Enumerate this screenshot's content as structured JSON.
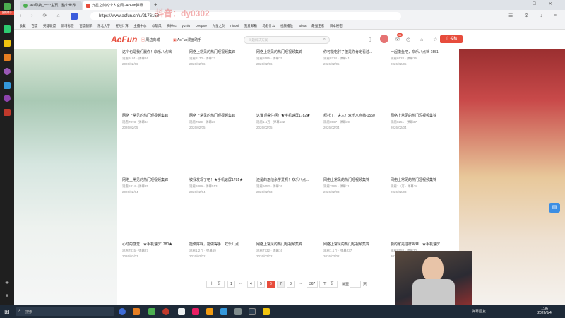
{
  "browser": {
    "sidebar_badge": "团购帮手",
    "tabs": [
      {
        "label": "360导航_一个主页，整个世界",
        "active": false
      },
      {
        "label": "九星之剑的个人空间 -AcFun弹幕...",
        "active": true
      }
    ],
    "url": "https://www.acfun.cn/u/2176158",
    "watermark": "抖音：dy0302",
    "bookmarks": [
      "收藏",
      "百度",
      "英雄联盟",
      "新增标签",
      "百度翻译",
      "东北大学",
      "在线计算",
      "主播中心",
      "@斩风",
      "梅棒cc",
      "yizhiu",
      "DeepSe",
      "九星之剑",
      "nicool",
      "我爱邮箱",
      "马老什么",
      "视频播放",
      "lolMa",
      "最强王者",
      "日本秘密"
    ]
  },
  "site": {
    "logo": "AcFun",
    "nav": [
      "周边商城",
      "AcFun漫画助手"
    ],
    "search_placeholder": "问题解决方案",
    "notif_count": "34",
    "upload_label": "投稿"
  },
  "videos": [
    {
      "title": "这个也是我们戳你！欢乐八点档",
      "views": "观看9101",
      "danmaku": "弹幕16",
      "date": "2026/02/06"
    },
    {
      "title": "网络上常见的热门短视频集锦",
      "views": "观看8170",
      "danmaku": "弹幕22",
      "date": "2026/02/06"
    },
    {
      "title": "网络上常见的热门短视频集锦",
      "views": "观看5585",
      "danmaku": "弹幕25",
      "date": "2026/02/06"
    },
    {
      "title": "你可能吃肘子但是你肯定看过...",
      "views": "观看8214",
      "danmaku": "弹幕41",
      "date": "2026/02/05"
    },
    {
      "title": "一起摸鱼吧，欢乐八点档-1551",
      "views": "观看6528",
      "danmaku": "弹幕26",
      "date": "2026/02/05"
    },
    {
      "title": "网络上常见的热门短视频集锦",
      "views": "观看7873",
      "danmaku": "弹幕34",
      "date": "2026/02/05"
    },
    {
      "title": "网络上常见的热门短视频集锦",
      "views": "观看7829",
      "danmaku": "弹幕28",
      "date": "2026/02/05"
    },
    {
      "title": "这谁顶得住啊！★手机速屏1782★",
      "views": "观看1.6万",
      "danmaku": "弹幕532",
      "date": "2026/02/05"
    },
    {
      "title": "拜托了，夫人！欢乐八点档-1550",
      "views": "观看8567",
      "danmaku": "弹幕39",
      "date": "2026/02/04"
    },
    {
      "title": "网络上常见的热门短视频集锦",
      "views": "观看8251",
      "danmaku": "弹幕37",
      "date": "2026/02/04"
    },
    {
      "title": "网络上常见的热门短视频集锦",
      "views": "观看6314",
      "danmaku": "弹幕25",
      "date": "2026/02/04"
    },
    {
      "title": "被我发现了吧！★手机速屏1781★",
      "views": "观看9389",
      "danmaku": "弹幕513",
      "date": "2026/02/04"
    },
    {
      "title": "还是的急他余学爱啊！欢乐八点...",
      "views": "观看6652",
      "danmaku": "弹幕26",
      "date": "2026/02/03"
    },
    {
      "title": "网络上常见的热门短视频集锦",
      "views": "观看7586",
      "danmaku": "弹幕11",
      "date": "2026/02/03"
    },
    {
      "title": "网络上常见的热门短视频集锦",
      "views": "观看1.1万",
      "danmaku": "弹幕38",
      "date": "2026/02/03"
    },
    {
      "title": "心动的感觉！★手机速屏1780★",
      "views": "观看7815",
      "danmaku": "弹幕27",
      "date": "2026/02/03"
    },
    {
      "title": "能做好啊，能做得手！欢乐八点...",
      "views": "观看1.2万",
      "danmaku": "弹幕69",
      "date": "2026/02/02"
    },
    {
      "title": "网络上常见的热门短视频集锦",
      "views": "观看7732",
      "danmaku": "弹幕16",
      "date": "2026/02/02"
    },
    {
      "title": "网络上常见的热门短视频集锦",
      "views": "观看1.1万",
      "danmaku": "弹幕237",
      "date": "2026/02/02"
    },
    {
      "title": "要的家是这样喝难！★手机速屏...",
      "views": "观看8558",
      "danmaku": "弹幕30",
      "date": "2026/02/02"
    }
  ],
  "pagination": {
    "prev": "上一页",
    "pages": [
      "1",
      "...",
      "4",
      "5",
      "6",
      "7",
      "8",
      "...",
      "367"
    ],
    "current": "6",
    "next": "下一页",
    "goto_label": "跳至",
    "page_unit": "页"
  },
  "taskbar": {
    "search_label": "搜索",
    "time": "1:36",
    "date": "2026/3/4",
    "notice": "弹幕回复"
  },
  "colors": {
    "accent": "#e74c3c",
    "sidebar": "#1f1f1f",
    "taskbar": "#1e2a38"
  }
}
